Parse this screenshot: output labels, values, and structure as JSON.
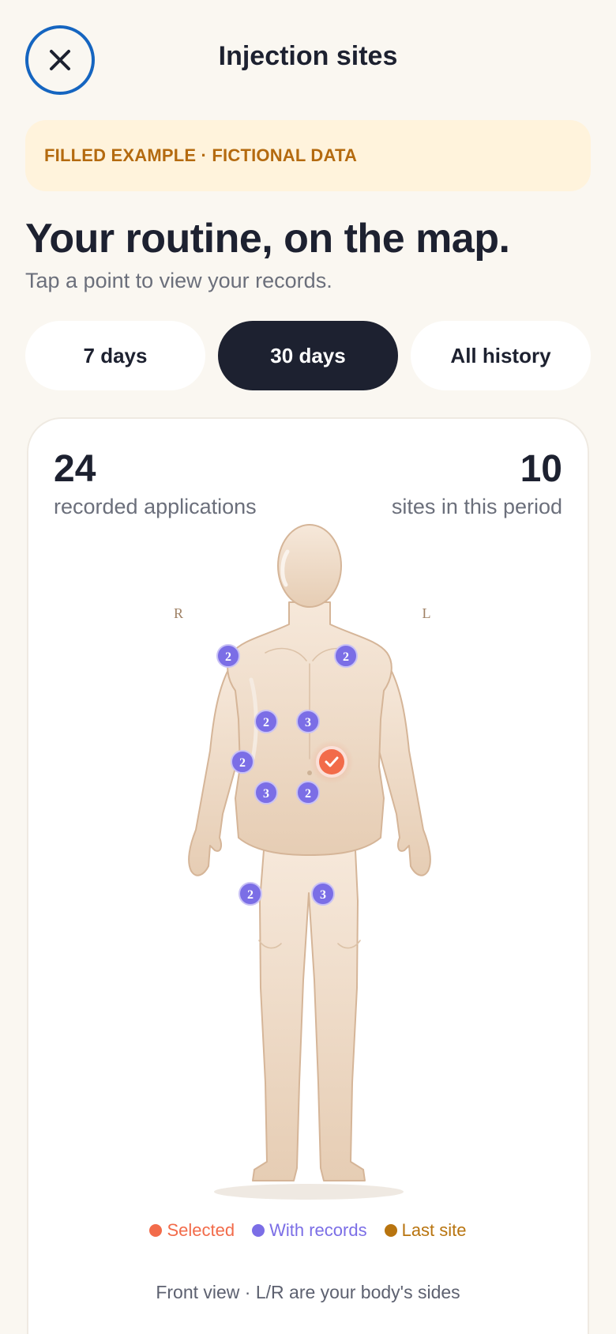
{
  "header": {
    "title": "Injection sites",
    "close_icon": "close-icon"
  },
  "banner": {
    "text": "FILLED EXAMPLE · FICTIONAL DATA"
  },
  "intro": {
    "headline": "Your routine, on the map.",
    "subhead": "Tap a point to view your records."
  },
  "filters": {
    "options": [
      "7 days",
      "30 days",
      "All history"
    ],
    "selected": "30 days"
  },
  "stats": {
    "applications_value": "24",
    "applications_label": "recorded applications",
    "sites_value": "10",
    "sites_label": "sites in this period"
  },
  "body_map": {
    "view": "front",
    "side_right_label": "R",
    "side_left_label": "L",
    "sites": [
      {
        "id": "right-upper-arm",
        "count": "2",
        "state": "records"
      },
      {
        "id": "left-upper-arm",
        "count": "2",
        "state": "records"
      },
      {
        "id": "upper-abdomen-right",
        "count": "2",
        "state": "records"
      },
      {
        "id": "upper-abdomen-left",
        "count": "3",
        "state": "records"
      },
      {
        "id": "flank-right",
        "count": "2",
        "state": "records"
      },
      {
        "id": "flank-left",
        "count": "",
        "state": "selected"
      },
      {
        "id": "lower-abdomen-right",
        "count": "3",
        "state": "records"
      },
      {
        "id": "lower-abdomen-left",
        "count": "2",
        "state": "records"
      },
      {
        "id": "right-thigh",
        "count": "2",
        "state": "records"
      },
      {
        "id": "left-thigh",
        "count": "3",
        "state": "records"
      }
    ]
  },
  "legend": {
    "selected": "Selected",
    "with_records": "With records",
    "last_site": "Last site"
  },
  "colors": {
    "selected": "#f26b4a",
    "with_records": "#7b6ee6",
    "last_site": "#b8740f",
    "accent_dark": "#1d2130",
    "close_ring": "#1565c0"
  },
  "footnote": "Front view · L/R are your body's sides"
}
